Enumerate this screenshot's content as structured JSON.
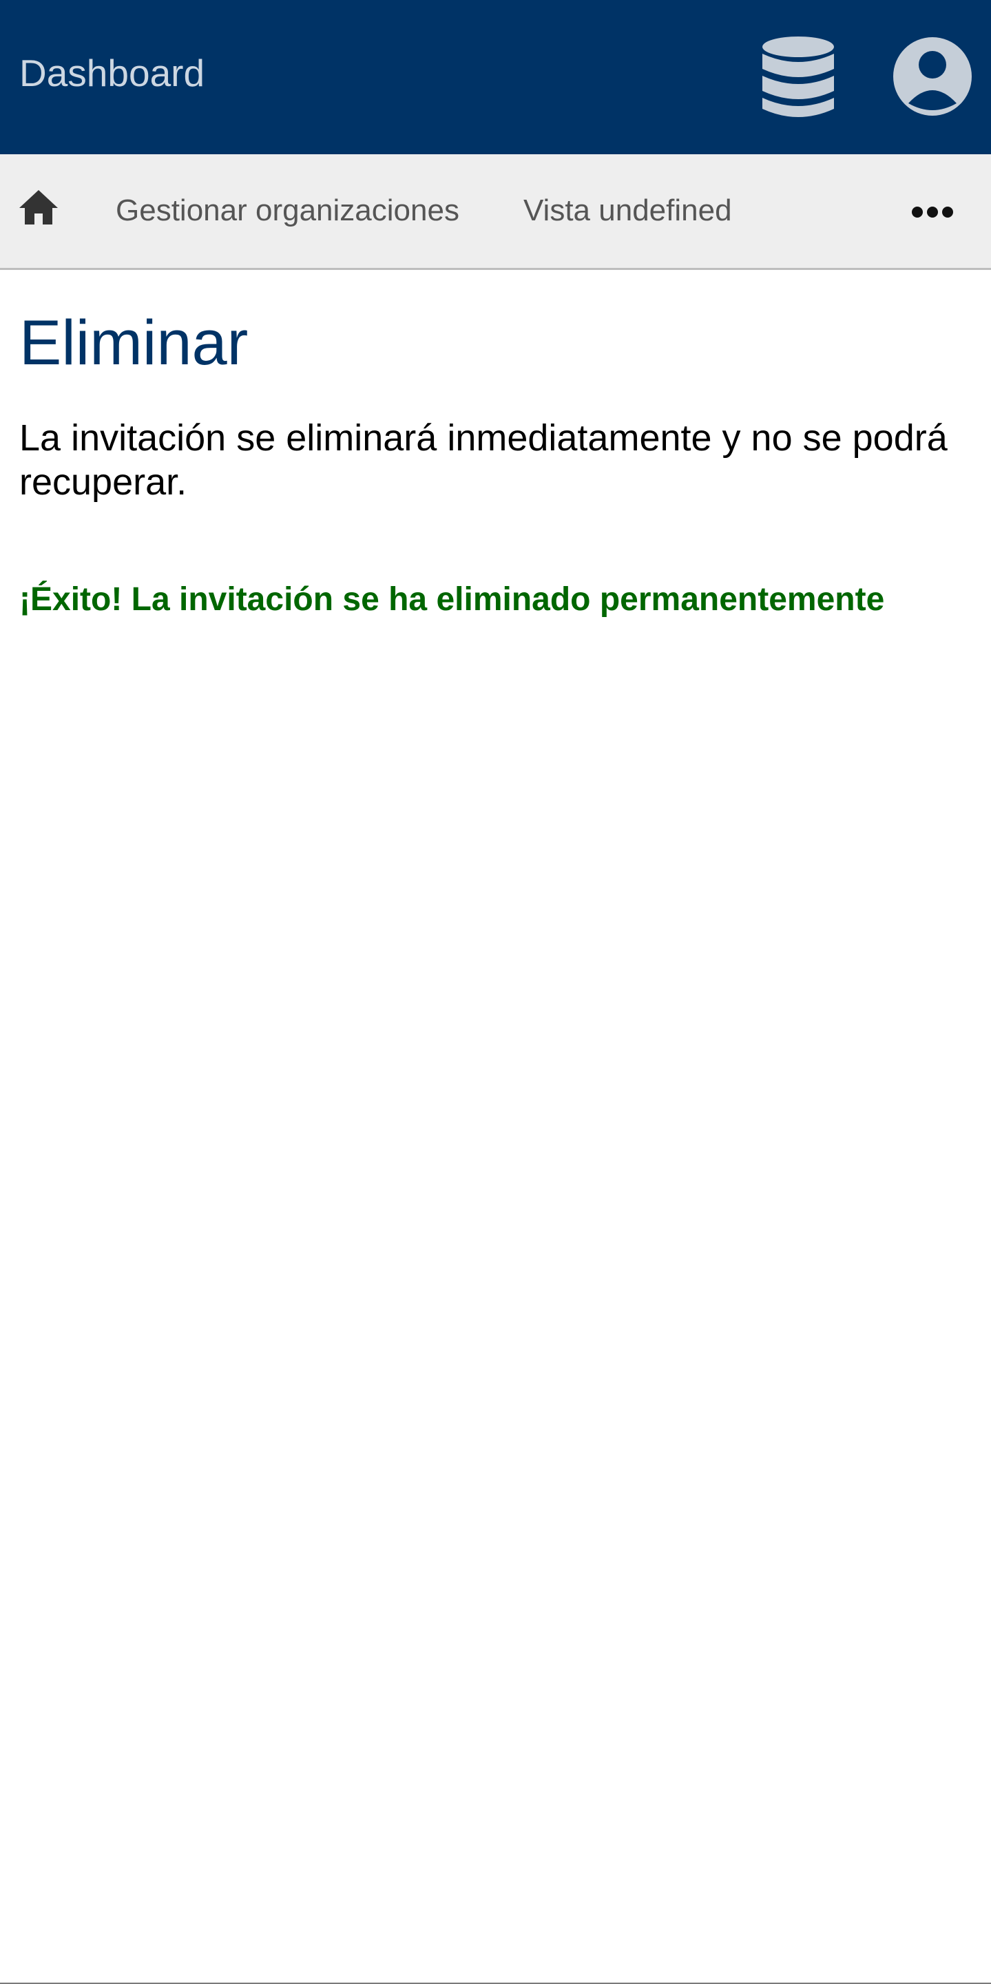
{
  "header": {
    "title": "Dashboard",
    "icons": {
      "database": "database-icon",
      "user": "user-circle-icon"
    },
    "colors": {
      "background": "#003366",
      "icon": "#c5ced8"
    }
  },
  "nav": {
    "home_icon": "home-icon",
    "items": [
      {
        "label": "Gestionar organizaciones"
      },
      {
        "label": "Vista undefined"
      }
    ],
    "more_icon": "more-horizontal-icon"
  },
  "main": {
    "title": "Eliminar",
    "description": "La invitación se eliminará inmediatamente y no se podrá recuperar.",
    "success_message": "¡Éxito! La invitación se ha eliminado permanentemente"
  },
  "colors": {
    "title": "#003366",
    "success": "#006600",
    "nav_background": "#eeeeee"
  }
}
